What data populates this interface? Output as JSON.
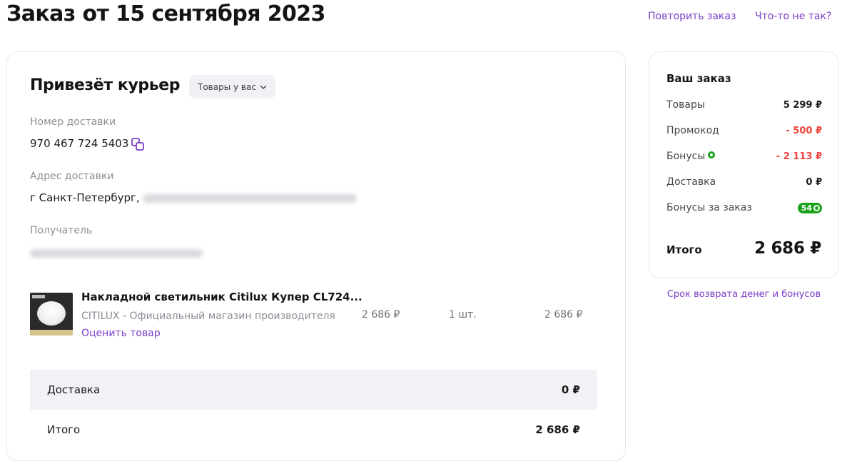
{
  "header": {
    "title": "Заказ от 15 сентября 2023",
    "repeat_link": "Повторить заказ",
    "problem_link": "Что-то не так?"
  },
  "delivery": {
    "title": "Привезёт курьер",
    "status_dropdown": "Товары у вас",
    "number_label": "Номер доставки",
    "number_value": "970 467 724 5403",
    "address_label": "Адрес доставки",
    "address_value": "г Санкт-Петербург,",
    "recipient_label": "Получатель"
  },
  "product": {
    "name": "Накладной светильник Citilux Купер CL724...",
    "shop": "CITILUX - Официальный магазин производителя",
    "rate_link": "Оценить товар",
    "price": "2 686 ₽",
    "quantity": "1 шт.",
    "total": "2 686 ₽"
  },
  "summary": {
    "delivery_label": "Доставка",
    "delivery_value": "0 ₽",
    "total_label": "Итого",
    "total_value": "2 686 ₽"
  },
  "sidebar": {
    "title": "Ваш заказ",
    "rows": [
      {
        "label": "Товары",
        "value": "5 299 ₽"
      },
      {
        "label": "Промокод",
        "value": "- 500 ₽"
      },
      {
        "label": "Бонусы",
        "value": "- 2 113 ₽"
      },
      {
        "label": "Доставка",
        "value": "0 ₽"
      },
      {
        "label": "Бонусы за заказ",
        "value": "54"
      }
    ],
    "total_label": "Итого",
    "total_value": "2 686 ₽",
    "refund_link": "Срок возврата денег и бонусов"
  },
  "colors": {
    "accent": "#7a3cc9",
    "negative": "#f0443e",
    "bonus_green": "#19a319"
  }
}
